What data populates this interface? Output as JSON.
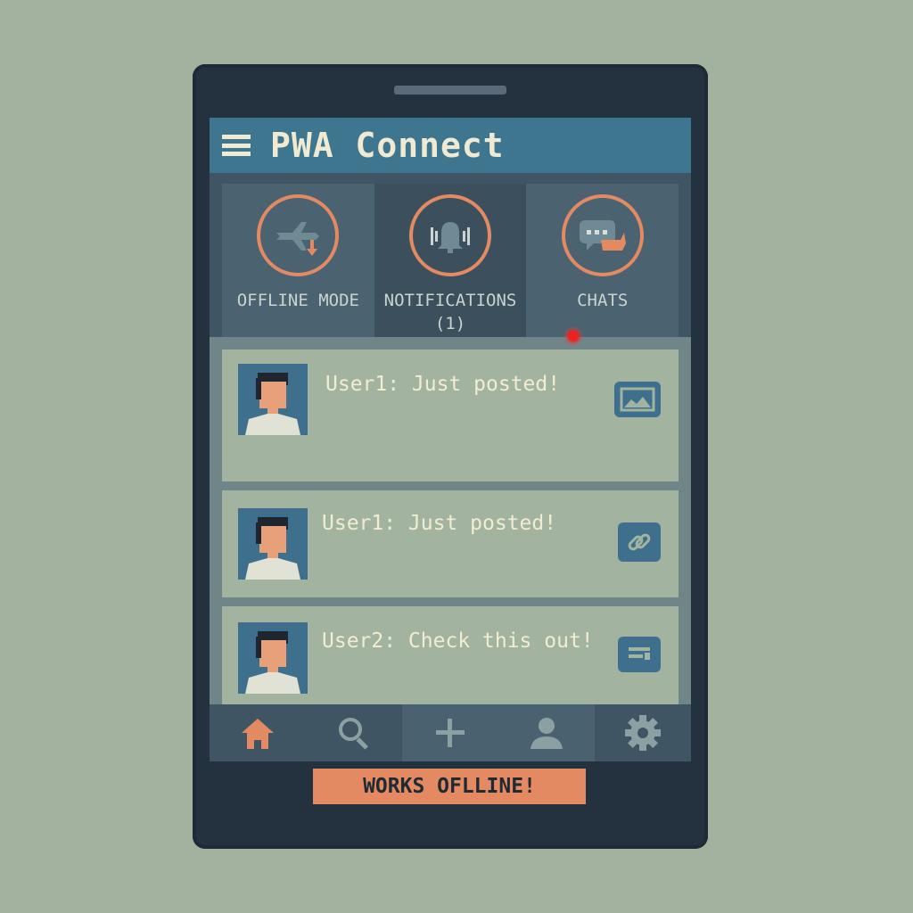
{
  "app": {
    "title": "PWA Connect"
  },
  "features": [
    {
      "label": "OFFLINE MODE",
      "icon": "plane-download-icon"
    },
    {
      "label": "NOTIFICATIONS",
      "sublabel": "(1)",
      "icon": "bell-icon"
    },
    {
      "label": "CHATS",
      "icon": "chat-icon"
    }
  ],
  "posts": [
    {
      "text": "User1: Just posted!",
      "action_icon": "image-icon"
    },
    {
      "text": "User1: Just posted!",
      "action_icon": "link-icon"
    },
    {
      "text": "User2: Check this out!",
      "action_icon": "message-icon"
    }
  ],
  "tabs": [
    "home-icon",
    "search-icon",
    "add-icon",
    "profile-icon",
    "settings-icon"
  ],
  "banner": {
    "text": "WORKS OFLLINE!"
  },
  "colors": {
    "accent": "#e48a63",
    "header": "#3e7690",
    "frame": "#24323f"
  }
}
